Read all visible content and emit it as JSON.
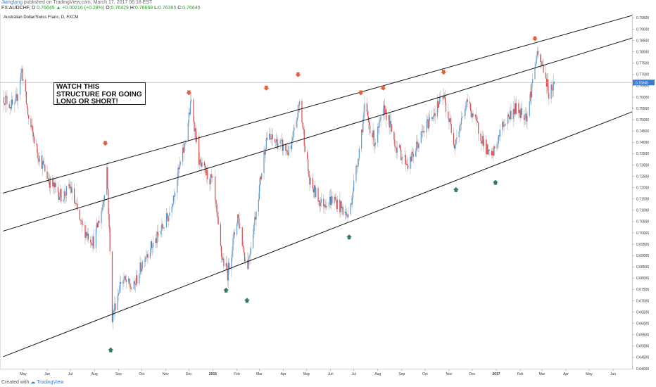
{
  "header": {
    "user": "Jianglang",
    "published": " published on TradingView.com, March 17, 2017 06:18 EST",
    "symbol": "FX:AUDCHF, D",
    "last": "0.76645",
    "change": "▲ +0.00216 (+0.28%)",
    "o_label": "O:",
    "o_value": "0.76429",
    "h_label": "H:",
    "h_value": "0.76669",
    "l_label": "L:",
    "l_value": "0.76365",
    "c_label": "C:",
    "c_value": "0.76645"
  },
  "chart_title": "Australian Dollar/Swiss Franc, D, FXCM",
  "annotation": "WATCH THIS\nSTRUCTURE FOR GOING\nLONG OR SHORT!",
  "footer": {
    "created": "Created with",
    "brand": "TradingView"
  },
  "colors": {
    "up": "#5b9bd5",
    "down": "#e0494b",
    "neutral": "#bdbdbd",
    "arrow_down": "#e06040",
    "arrow_up": "#2e7d5b",
    "line": "#111111",
    "hline": "#9fb9e0",
    "price_label_bg": "#3a7bd5"
  },
  "chart_data": {
    "type": "candlestick",
    "title": "Australian Dollar/Swiss Franc, D, FXCM",
    "ylim": [
      0.64,
      0.797
    ],
    "y_ticks": [
      "0.79500",
      "0.79000",
      "0.78500",
      "0.78000",
      "0.77500",
      "0.77000",
      "0.76500",
      "0.76000",
      "0.75500",
      "0.75000",
      "0.74500",
      "0.74000",
      "0.73500",
      "0.73000",
      "0.72500",
      "0.72000",
      "0.71500",
      "0.71000",
      "0.70500",
      "0.70000",
      "0.69500",
      "0.69000",
      "0.68500",
      "0.68000",
      "0.67500",
      "0.67000",
      "0.66500",
      "0.66000",
      "0.65500",
      "0.65000",
      "0.64500",
      "0.64000"
    ],
    "x_ticks": [
      {
        "label": "May",
        "date": "2015-05-01"
      },
      {
        "label": "Jun",
        "date": "2015-06-01"
      },
      {
        "label": "Jul",
        "date": "2015-07-01"
      },
      {
        "label": "Aug",
        "date": "2015-08-01"
      },
      {
        "label": "Sep",
        "date": "2015-09-01"
      },
      {
        "label": "Oct",
        "date": "2015-10-01"
      },
      {
        "label": "Nov",
        "date": "2015-11-01"
      },
      {
        "label": "Dec",
        "date": "2015-12-01"
      },
      {
        "label": "2016",
        "date": "2016-01-01",
        "bold": true
      },
      {
        "label": "Feb",
        "date": "2016-02-01"
      },
      {
        "label": "Mar",
        "date": "2016-03-01"
      },
      {
        "label": "Apr",
        "date": "2016-04-01"
      },
      {
        "label": "May",
        "date": "2016-05-01"
      },
      {
        "label": "Jun",
        "date": "2016-06-01"
      },
      {
        "label": "Jul",
        "date": "2016-07-01"
      },
      {
        "label": "Aug",
        "date": "2016-08-01"
      },
      {
        "label": "Sep",
        "date": "2016-09-01"
      },
      {
        "label": "Oct",
        "date": "2016-10-01"
      },
      {
        "label": "Nov",
        "date": "2016-11-01"
      },
      {
        "label": "Dec",
        "date": "2016-12-01"
      },
      {
        "label": "2017",
        "date": "2017-01-01",
        "bold": true
      },
      {
        "label": "Feb",
        "date": "2017-02-01"
      },
      {
        "label": "Mar",
        "date": "2017-03-01"
      },
      {
        "label": "Apr",
        "date": "2017-04-01"
      },
      {
        "label": "May",
        "date": "2017-05-01"
      },
      {
        "label": "Jun",
        "date": "2017-06-01"
      },
      {
        "label": "Jul",
        "date": "2017-07-01"
      }
    ],
    "last_price": 0.76645,
    "last_price_label": "0.76645",
    "trend_lines": [
      {
        "name": "channel-upper",
        "from": {
          "date": "2015-04-05",
          "price": 0.7176
        },
        "to": {
          "date": "2017-07-05",
          "price": 0.797
        }
      },
      {
        "name": "channel-middle",
        "from": {
          "date": "2015-04-05",
          "price": 0.7008
        },
        "to": {
          "date": "2017-07-31",
          "price": 0.7898
        }
      },
      {
        "name": "channel-lower",
        "from": {
          "date": "2015-04-05",
          "price": 0.6453
        },
        "to": {
          "date": "2017-07-31",
          "price": 0.7582
        }
      }
    ],
    "arrows_down": [
      {
        "date": "2015-08-15",
        "price": 0.7394
      },
      {
        "date": "2015-12-01",
        "price": 0.7617
      },
      {
        "date": "2016-03-10",
        "price": 0.7638
      },
      {
        "date": "2016-04-20",
        "price": 0.7697
      },
      {
        "date": "2016-07-10",
        "price": 0.7617
      },
      {
        "date": "2016-08-08",
        "price": 0.7638
      },
      {
        "date": "2016-10-25",
        "price": 0.7708
      },
      {
        "date": "2017-02-20",
        "price": 0.7856
      }
    ],
    "arrows_up": [
      {
        "date": "2015-08-22",
        "price": 0.6485
      },
      {
        "date": "2016-01-18",
        "price": 0.6749
      },
      {
        "date": "2016-02-14",
        "price": 0.6704
      },
      {
        "date": "2016-06-25",
        "price": 0.6984
      },
      {
        "date": "2016-11-10",
        "price": 0.7193
      },
      {
        "date": "2016-12-31",
        "price": 0.7225
      }
    ],
    "price_path": [
      [
        "2015-04-05",
        0.76
      ],
      [
        "2015-04-20",
        0.755
      ],
      [
        "2015-04-29",
        0.772
      ],
      [
        "2015-05-08",
        0.75
      ],
      [
        "2015-05-20",
        0.735
      ],
      [
        "2015-06-05",
        0.722
      ],
      [
        "2015-06-20",
        0.716
      ],
      [
        "2015-07-01",
        0.72
      ],
      [
        "2015-07-15",
        0.703
      ],
      [
        "2015-07-31",
        0.696
      ],
      [
        "2015-08-12",
        0.713
      ],
      [
        "2015-08-17",
        0.729
      ],
      [
        "2015-08-24",
        0.663
      ],
      [
        "2015-09-05",
        0.68
      ],
      [
        "2015-09-20",
        0.675
      ],
      [
        "2015-10-05",
        0.69
      ],
      [
        "2015-10-20",
        0.697
      ],
      [
        "2015-11-05",
        0.708
      ],
      [
        "2015-11-25",
        0.738
      ],
      [
        "2015-12-04",
        0.758
      ],
      [
        "2015-12-15",
        0.73
      ],
      [
        "2016-01-01",
        0.722
      ],
      [
        "2016-01-12",
        0.69
      ],
      [
        "2016-01-20",
        0.682
      ],
      [
        "2016-02-02",
        0.708
      ],
      [
        "2016-02-14",
        0.684
      ],
      [
        "2016-02-25",
        0.708
      ],
      [
        "2016-03-10",
        0.742
      ],
      [
        "2016-03-25",
        0.74
      ],
      [
        "2016-04-10",
        0.735
      ],
      [
        "2016-04-22",
        0.758
      ],
      [
        "2016-05-05",
        0.722
      ],
      [
        "2016-05-20",
        0.713
      ],
      [
        "2016-06-05",
        0.715
      ],
      [
        "2016-06-24",
        0.707
      ],
      [
        "2016-07-05",
        0.73
      ],
      [
        "2016-07-15",
        0.755
      ],
      [
        "2016-07-28",
        0.74
      ],
      [
        "2016-08-10",
        0.755
      ],
      [
        "2016-08-25",
        0.738
      ],
      [
        "2016-09-10",
        0.73
      ],
      [
        "2016-09-25",
        0.742
      ],
      [
        "2016-10-10",
        0.752
      ],
      [
        "2016-10-25",
        0.76
      ],
      [
        "2016-11-08",
        0.74
      ],
      [
        "2016-11-25",
        0.758
      ],
      [
        "2016-12-10",
        0.745
      ],
      [
        "2016-12-25",
        0.732
      ],
      [
        "2017-01-10",
        0.748
      ],
      [
        "2017-01-25",
        0.755
      ],
      [
        "2017-02-10",
        0.752
      ],
      [
        "2017-02-22",
        0.778
      ],
      [
        "2017-03-03",
        0.773
      ],
      [
        "2017-03-10",
        0.762
      ],
      [
        "2017-03-17",
        0.766
      ]
    ]
  }
}
